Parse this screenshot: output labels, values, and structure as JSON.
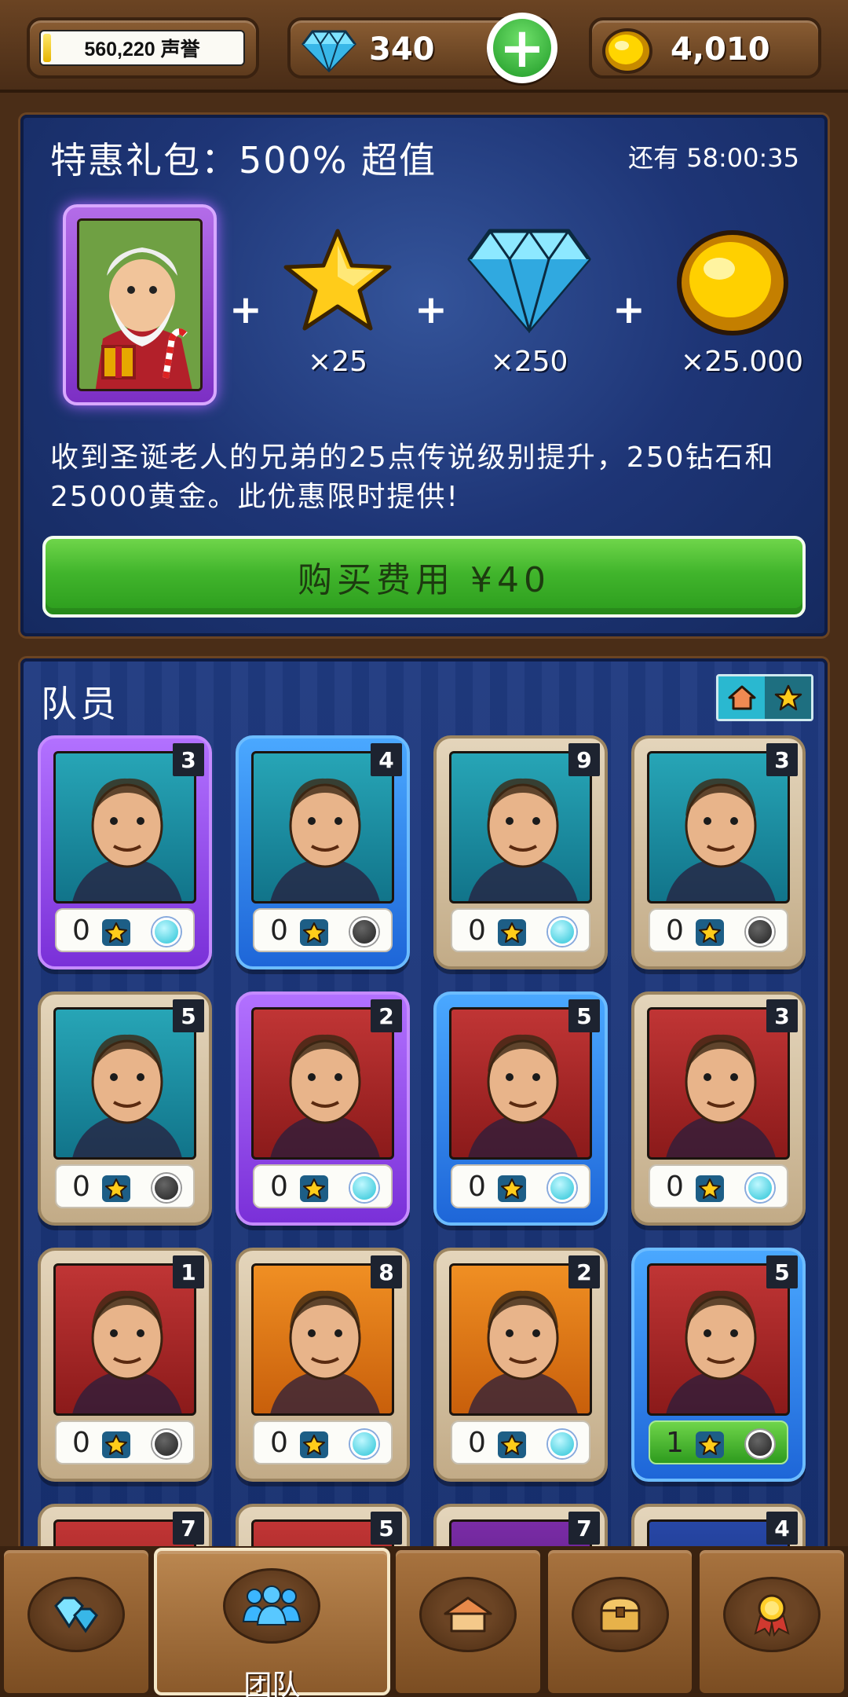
{
  "topbar": {
    "reputation": "560,220 声誉",
    "gems": "340",
    "gold": "4,010"
  },
  "offer": {
    "title": "特惠礼包：500% 超值",
    "timer": "还有 58:00:35",
    "items": [
      {
        "icon": "star-icon",
        "qty": "×25"
      },
      {
        "icon": "gem-icon",
        "qty": "×250"
      },
      {
        "icon": "coin-icon",
        "qty": "×25.000"
      }
    ],
    "description": "收到圣诞老人的兄弟的25点传说级别提升，250钻石和25000黄金。此优惠限时提供!",
    "buy_label": "购买费用 ¥40"
  },
  "crew": {
    "title": "队员",
    "members": [
      {
        "level": "3",
        "stars": "0",
        "rarity": "epic",
        "bg": "teal",
        "dot": "on"
      },
      {
        "level": "4",
        "stars": "0",
        "rarity": "rare",
        "bg": "teal",
        "dot": "off"
      },
      {
        "level": "9",
        "stars": "0",
        "rarity": "common",
        "bg": "teal",
        "dot": "on"
      },
      {
        "level": "3",
        "stars": "0",
        "rarity": "common",
        "bg": "teal",
        "dot": "off"
      },
      {
        "level": "5",
        "stars": "0",
        "rarity": "common",
        "bg": "teal",
        "dot": "off"
      },
      {
        "level": "2",
        "stars": "0",
        "rarity": "epic",
        "bg": "red",
        "dot": "on"
      },
      {
        "level": "5",
        "stars": "0",
        "rarity": "rare",
        "bg": "red",
        "dot": "on"
      },
      {
        "level": "3",
        "stars": "0",
        "rarity": "common",
        "bg": "red",
        "dot": "on"
      },
      {
        "level": "1",
        "stars": "0",
        "rarity": "common",
        "bg": "red",
        "dot": "off"
      },
      {
        "level": "8",
        "stars": "0",
        "rarity": "common",
        "bg": "orange",
        "dot": "on"
      },
      {
        "level": "2",
        "stars": "0",
        "rarity": "common",
        "bg": "orange",
        "dot": "on"
      },
      {
        "level": "5",
        "stars": "1",
        "rarity": "rare",
        "bg": "red",
        "dot": "off"
      },
      {
        "level": "7",
        "stars": "",
        "rarity": "common",
        "bg": "red",
        "dot": "none"
      },
      {
        "level": "5",
        "stars": "",
        "rarity": "common",
        "bg": "red",
        "dot": "none"
      },
      {
        "level": "7",
        "stars": "",
        "rarity": "common",
        "bg": "purple",
        "dot": "none"
      },
      {
        "level": "4",
        "stars": "",
        "rarity": "common",
        "bg": "blue",
        "dot": "none"
      }
    ]
  },
  "nav": {
    "tabs": [
      {
        "icon": "gems-icon",
        "label": ""
      },
      {
        "icon": "team-icon",
        "label": "团队"
      },
      {
        "icon": "house-icon",
        "label": ""
      },
      {
        "icon": "chest-icon",
        "label": ""
      },
      {
        "icon": "medal-icon",
        "label": ""
      }
    ]
  },
  "colors": {
    "panel_blue": "#1e3576",
    "wood": "#6b4423",
    "buy_green": "#41b52c"
  }
}
